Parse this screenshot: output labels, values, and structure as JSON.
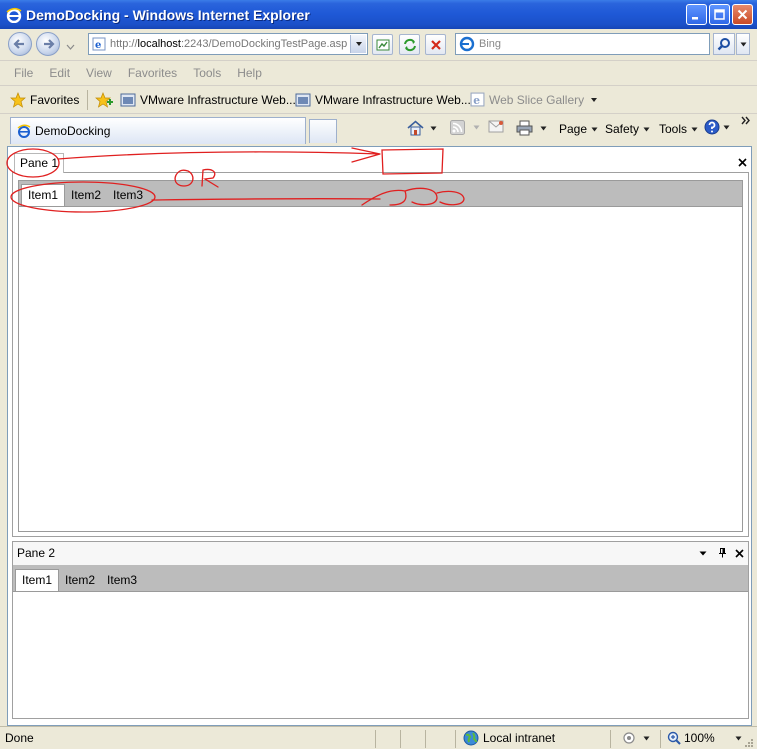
{
  "window": {
    "title": "DemoDocking - Windows Internet Explorer"
  },
  "address_bar": {
    "url_prefix": "http://",
    "url_host": "localhost",
    "url_rest": ":2243/DemoDockingTestPage.asp:"
  },
  "search": {
    "placeholder": "Bing"
  },
  "menu": {
    "items": [
      "File",
      "Edit",
      "View",
      "Favorites",
      "Tools",
      "Help"
    ]
  },
  "favorites_bar": {
    "favorites_label": "Favorites",
    "links": [
      "VMware Infrastructure Web...",
      "VMware Infrastructure Web...",
      "Web Slice Gallery"
    ]
  },
  "tabs": {
    "active_tab_label": "DemoDocking"
  },
  "command_bar": {
    "page_label": "Page",
    "safety_label": "Safety",
    "tools_label": "Tools"
  },
  "pane1": {
    "title": "Pane 1",
    "tabs": [
      "Item1",
      "Item2",
      "Item3"
    ]
  },
  "pane2": {
    "title": "Pane 2",
    "tabs": [
      "Item1",
      "Item2",
      "Item3"
    ]
  },
  "annotation": {
    "text": "OR"
  },
  "status_bar": {
    "status": "Done",
    "zone": "Local intranet",
    "zoom": "100%"
  },
  "colors": {
    "title_bar": "#1e58d6",
    "chrome": "#ece9d8",
    "annotation": "#e02020",
    "tab_strip": "#bcbcbc"
  }
}
